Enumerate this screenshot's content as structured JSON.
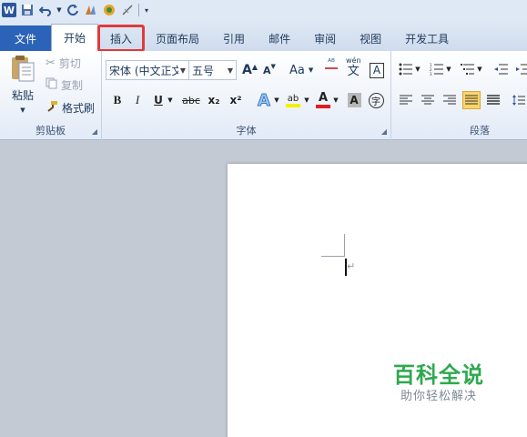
{
  "quick_access": {
    "app_logo": "W",
    "items": [
      "save-icon",
      "undo-icon",
      "redo-icon",
      "format-painter-icon",
      "color-icon",
      "clear-icon",
      "customize-icon"
    ]
  },
  "tabs": [
    {
      "label": "文件"
    },
    {
      "label": "开始"
    },
    {
      "label": "插入"
    },
    {
      "label": "页面布局"
    },
    {
      "label": "引用"
    },
    {
      "label": "邮件"
    },
    {
      "label": "审阅"
    },
    {
      "label": "视图"
    },
    {
      "label": "开发工具"
    }
  ],
  "clipboard": {
    "paste_label": "粘贴",
    "cut_label": "剪切",
    "copy_label": "复制",
    "format_painter_label": "格式刷",
    "group_label": "剪贴板"
  },
  "font": {
    "font_name": "宋体 (中文正文",
    "font_size": "五号",
    "group_label": "字体",
    "grow_label": "A",
    "shrink_label": "A",
    "case_label": "Aa",
    "bold_label": "B",
    "italic_label": "I",
    "underline_label": "U",
    "strike_label": "abc",
    "subscript_label": "x₂",
    "superscript_label": "x²",
    "effects_label": "A",
    "highlight_label": "ab",
    "font_color_label": "A",
    "shading_label": "A",
    "enclose_label": "字",
    "phonetic_label": "wén",
    "phonetic_char": "文",
    "border_char": "A"
  },
  "paragraph": {
    "group_label": "段落"
  },
  "document": {
    "watermark_title": "百科全说",
    "watermark_subtitle": "助你轻松解决"
  },
  "colors": {
    "file_tab": "#2b63b8",
    "highlight_box": "#e03a3a",
    "watermark_green": "#2fa84f"
  }
}
